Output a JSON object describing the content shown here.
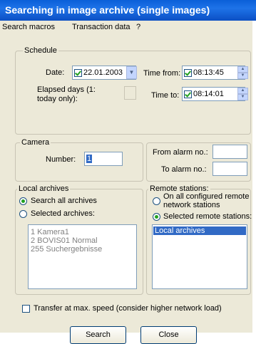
{
  "window": {
    "title": "Searching in image archive (single images)"
  },
  "menu": [
    "Search macros",
    "Transaction data",
    "?"
  ],
  "schedule": {
    "legend": "Schedule",
    "date_label": "Date:",
    "date_value": "22.01.2003",
    "date_checked": true,
    "time_from_label": "Time from:",
    "time_from_value": "08:13:45",
    "time_from_checked": true,
    "elapsed_label_1": "Elapsed days (1:",
    "elapsed_label_2": "today only):",
    "time_to_label": "Time to:",
    "time_to_value": "08:14:01",
    "time_to_checked": true
  },
  "camera": {
    "legend": "Camera",
    "number_label": "Number:",
    "number_value": "1",
    "from_alarm_label": "From alarm no.:",
    "to_alarm_label": "To alarm no.:"
  },
  "local_archives": {
    "legend": "Local archives",
    "option_all": "Search all archives",
    "option_selected": "Selected archives:",
    "items": [
      "1  Kamera1",
      "2  BOVIS01 Normal",
      "255  Suchergebnisse"
    ]
  },
  "remote_stations": {
    "legend": "Remote stations:",
    "option_all_1": "On all configured remote",
    "option_all_2": "network stations",
    "option_selected": "Selected remote stations:",
    "items": [
      "Local archives"
    ]
  },
  "transfer": {
    "label": "Transfer at max. speed (consider higher network load)",
    "checked": false
  },
  "buttons": {
    "search": "Search",
    "close": "Close"
  }
}
